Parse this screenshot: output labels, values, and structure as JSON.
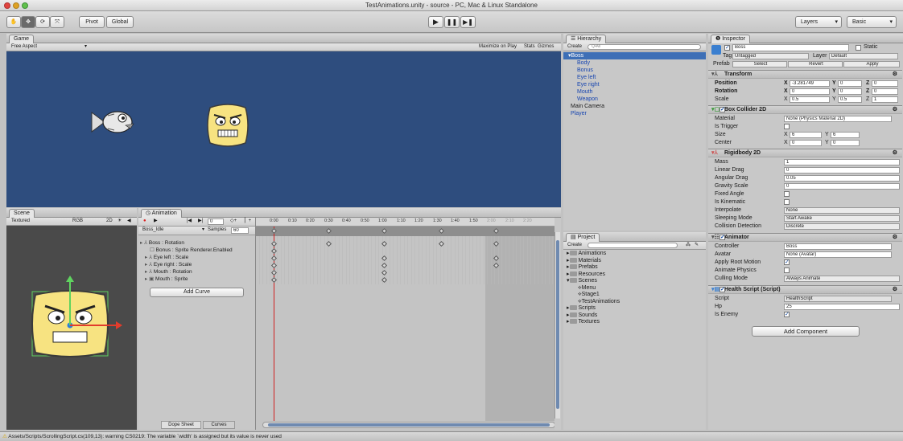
{
  "window": {
    "title": "TestAnimations.unity - source - PC, Mac & Linux Standalone"
  },
  "toolbar": {
    "pivot_label": "Pivot",
    "global_label": "Global",
    "play_icon": "play-icon",
    "pause_icon": "pause-icon",
    "step_icon": "step-icon",
    "layers_label": "Layers",
    "layout_label": "Basic"
  },
  "game": {
    "tab": "Game",
    "aspect": "Free Aspect",
    "maximize_on_play": "Maximize on Play",
    "stats": "Stats",
    "gizmos": "Gizmos",
    "bg_color": "#2e4d7e"
  },
  "scene": {
    "tab": "Scene",
    "shading": "Textured",
    "color_mode": "RGB",
    "mode_2d": "2D"
  },
  "hierarchy": {
    "tab": "Hierarchy",
    "create": "Create",
    "search_placeholder": "Q•All",
    "items": [
      {
        "label": "Boss",
        "indent": 0,
        "selected": true
      },
      {
        "label": "Body",
        "indent": 1
      },
      {
        "label": "Bonus",
        "indent": 1
      },
      {
        "label": "Eye left",
        "indent": 1
      },
      {
        "label": "Eye right",
        "indent": 1
      },
      {
        "label": "Mouth",
        "indent": 1
      },
      {
        "label": "Weapon",
        "indent": 1
      },
      {
        "label": "Main Camera",
        "indent": 0
      },
      {
        "label": "Player",
        "indent": 0
      }
    ]
  },
  "animation": {
    "tab": "Animation",
    "frame": "0",
    "clip": "Boss_Idle",
    "samples_label": "Samples",
    "samples_value": "60",
    "ticks": [
      "0:00",
      "0:10",
      "0:20",
      "0:30",
      "0:40",
      "0:50",
      "1:00",
      "1:10",
      "1:20",
      "1:30",
      "1:40",
      "1:50",
      "2:00",
      "2:10",
      "2:20"
    ],
    "properties": [
      "Boss : Rotation",
      "Bonus : Sprite Renderer.Enabled",
      "Eye left : Scale",
      "Eye right : Scale",
      "Mouth : Rotation",
      "Mouth : Sprite"
    ],
    "add_curve": "Add Curve",
    "dope_sheet": "Dope Sheet",
    "curves": "Curves"
  },
  "project": {
    "tab": "Project",
    "create": "Create",
    "items": [
      {
        "label": "Animations",
        "type": "folder",
        "indent": 0
      },
      {
        "label": "Materials",
        "type": "folder",
        "indent": 0
      },
      {
        "label": "Prefabs",
        "type": "folder",
        "indent": 0
      },
      {
        "label": "Resources",
        "type": "folder",
        "indent": 0
      },
      {
        "label": "Scenes",
        "type": "folder",
        "indent": 0
      },
      {
        "label": "Menu",
        "type": "scene",
        "indent": 1
      },
      {
        "label": "Stage1",
        "type": "scene",
        "indent": 1
      },
      {
        "label": "TestAnimations",
        "type": "scene",
        "indent": 1
      },
      {
        "label": "Scripts",
        "type": "folder",
        "indent": 0
      },
      {
        "label": "Sounds",
        "type": "folder",
        "indent": 0
      },
      {
        "label": "Textures",
        "type": "folder",
        "indent": 0
      }
    ]
  },
  "inspector": {
    "tab": "Inspector",
    "name": "Boss",
    "static": "Static",
    "tag_label": "Tag",
    "tag_value": "Untagged",
    "layer_label": "Layer",
    "layer_value": "Default",
    "prefab_label": "Prefab",
    "prefab_select": "Select",
    "prefab_revert": "Revert",
    "prefab_apply": "Apply",
    "transform": {
      "title": "Transform",
      "position": "Position",
      "pos_x": "-3.281749",
      "pos_y": "0",
      "pos_z": "0",
      "rotation": "Rotation",
      "rot_x": "0",
      "rot_y": "0",
      "rot_z": "0",
      "scale": "Scale",
      "scale_x": "0.5",
      "scale_y": "0.5",
      "scale_z": "1"
    },
    "box_collider": {
      "title": "Box Collider 2D",
      "material": "Material",
      "material_value": "None (Physics Material 2D)",
      "is_trigger": "Is Trigger",
      "size": "Size",
      "size_x": "6",
      "size_y": "6",
      "center": "Center",
      "center_x": "0",
      "center_y": "0"
    },
    "rigidbody": {
      "title": "Rigidbody 2D",
      "mass": "Mass",
      "mass_value": "1",
      "linear_drag": "Linear Drag",
      "linear_drag_value": "0",
      "angular_drag": "Angular Drag",
      "angular_drag_value": "0.05",
      "gravity_scale": "Gravity Scale",
      "gravity_scale_value": "0",
      "fixed_angle": "Fixed Angle",
      "is_kinematic": "Is Kinematic",
      "interpolate": "Interpolate",
      "interpolate_value": "None",
      "sleeping_mode": "Sleeping Mode",
      "sleeping_mode_value": "Start Awake",
      "collision_detection": "Collision Detection",
      "collision_detection_value": "Discrete"
    },
    "animator": {
      "title": "Animator",
      "controller": "Controller",
      "controller_value": "Boss",
      "avatar": "Avatar",
      "avatar_value": "None (Avatar)",
      "apply_root_motion": "Apply Root Motion",
      "animate_physics": "Animate Physics",
      "culling_mode": "Culling Mode",
      "culling_mode_value": "Always Animate"
    },
    "health_script": {
      "title": "Health Script (Script)",
      "script": "Script",
      "script_value": "HealthScript",
      "hp": "Hp",
      "hp_value": "25",
      "is_enemy": "Is Enemy"
    },
    "add_component": "Add Component"
  },
  "status": {
    "message": "Assets/Scripts/ScrollingScript.cs(109,13): warning CS0219: The variable `width' is assigned but its value is never used"
  }
}
